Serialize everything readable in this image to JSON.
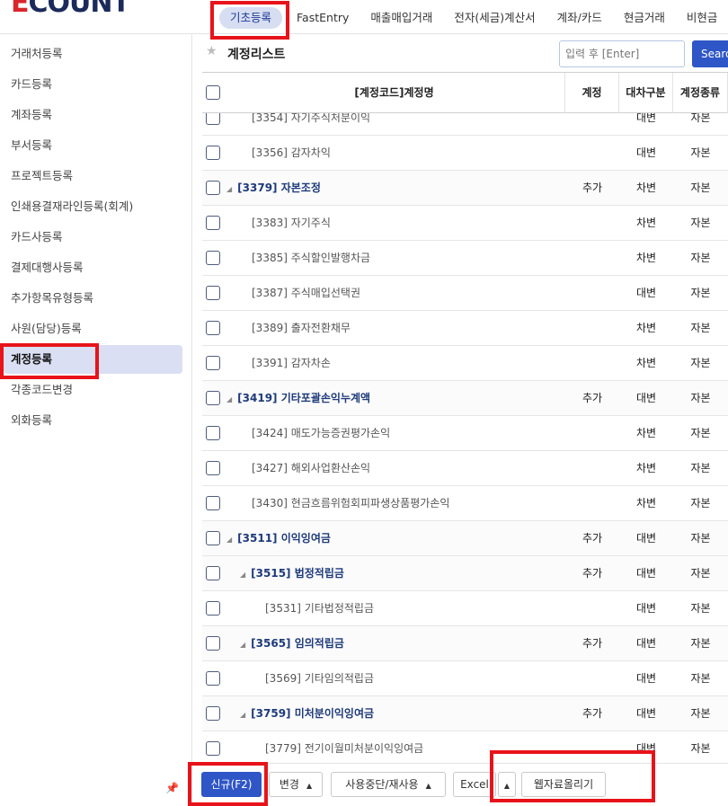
{
  "app": {
    "logo_e": "E",
    "logo_rest": "COUNT"
  },
  "menu": [
    {
      "label": "기초등록"
    },
    {
      "label": "FastEntry"
    },
    {
      "label": "매출매입거래"
    },
    {
      "label": "전자(세금)계산서"
    },
    {
      "label": "계좌/카드"
    },
    {
      "label": "현금거래"
    },
    {
      "label": "비현금"
    }
  ],
  "sidebar": {
    "items": [
      {
        "label": "거래처등록"
      },
      {
        "label": "카드등록"
      },
      {
        "label": "계좌등록"
      },
      {
        "label": "부서등록"
      },
      {
        "label": "프로젝트등록"
      },
      {
        "label": "인쇄용결재라인등록(회계)"
      },
      {
        "label": "카드사등록"
      },
      {
        "label": "결제대행사등록"
      },
      {
        "label": "추가항목유형등록"
      },
      {
        "label": "사원(담당)등록"
      },
      {
        "label": "계정등록"
      },
      {
        "label": "각종코드변경"
      },
      {
        "label": "외화등록"
      }
    ]
  },
  "main": {
    "title": "계정리스트",
    "search_placeholder": "입력 후 [Enter]",
    "search_button": "Search"
  },
  "table": {
    "headers": [
      "[계정코드]계정명",
      "계정",
      "대차구분",
      "계정종류"
    ],
    "rows": [
      {
        "name": "[3354] 자기주식처분이익",
        "kind": "",
        "dc": "대변",
        "type": "자본"
      },
      {
        "name": "[3356] 감자차익",
        "kind": "",
        "dc": "대변",
        "type": "자본"
      },
      {
        "name": "[3379] 자본조정",
        "kind": "추가",
        "dc": "차변",
        "type": "자본"
      },
      {
        "name": "[3383] 자기주식",
        "kind": "",
        "dc": "차변",
        "type": "자본"
      },
      {
        "name": "[3385] 주식할인발행차금",
        "kind": "",
        "dc": "차변",
        "type": "자본"
      },
      {
        "name": "[3387] 주식매입선택권",
        "kind": "",
        "dc": "대변",
        "type": "자본"
      },
      {
        "name": "[3389] 출자전환채무",
        "kind": "",
        "dc": "차변",
        "type": "자본"
      },
      {
        "name": "[3391] 감자차손",
        "kind": "",
        "dc": "차변",
        "type": "자본"
      },
      {
        "name": "[3419] 기타포괄손익누계액",
        "kind": "추가",
        "dc": "대변",
        "type": "자본"
      },
      {
        "name": "[3424] 매도가능증권평가손익",
        "kind": "",
        "dc": "차변",
        "type": "자본"
      },
      {
        "name": "[3427] 해외사업환산손익",
        "kind": "",
        "dc": "차변",
        "type": "자본"
      },
      {
        "name": "[3430] 현금흐름위험회피파생상품평가손익",
        "kind": "",
        "dc": "차변",
        "type": "자본"
      },
      {
        "name": "[3511] 이익잉여금",
        "kind": "추가",
        "dc": "대변",
        "type": "자본"
      },
      {
        "name": "[3515] 법정적립금",
        "kind": "추가",
        "dc": "대변",
        "type": "자본"
      },
      {
        "name": "[3531] 기타법정적립금",
        "kind": "",
        "dc": "대변",
        "type": "자본"
      },
      {
        "name": "[3565] 임의적립금",
        "kind": "추가",
        "dc": "대변",
        "type": "자본"
      },
      {
        "name": "[3569] 기타임의적립금",
        "kind": "",
        "dc": "대변",
        "type": "자본"
      },
      {
        "name": "[3759] 미처분이익잉여금",
        "kind": "추가",
        "dc": "대변",
        "type": "자본"
      },
      {
        "name": "[3779] 전기이월미처분이익잉여금",
        "kind": "",
        "dc": "대변",
        "type": "자본"
      }
    ]
  },
  "footer": {
    "new_button": "신규(F2)",
    "change_button": "변경",
    "suspend_button": "사용중단/재사용",
    "excel_button": "Excel",
    "web_upload_button": "웹자료올리기"
  }
}
